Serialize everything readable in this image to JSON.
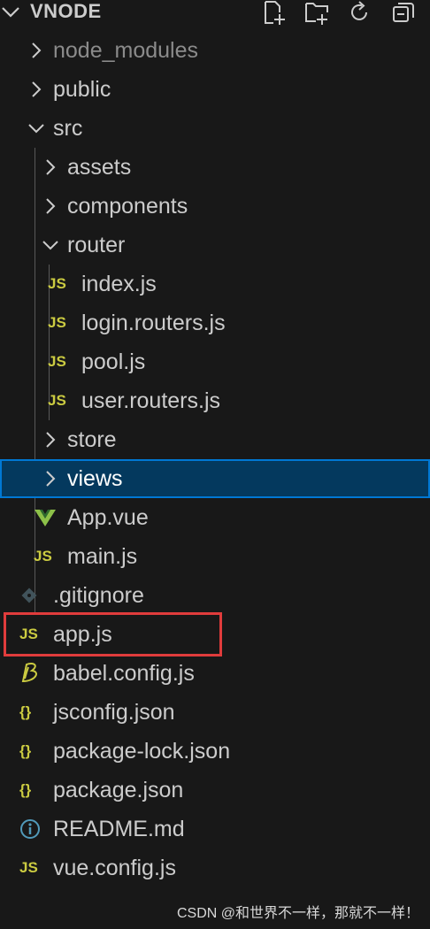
{
  "header": {
    "title": "VNODE",
    "actions": [
      {
        "name": "new-file-icon"
      },
      {
        "name": "new-folder-icon"
      },
      {
        "name": "refresh-icon"
      },
      {
        "name": "collapse-all-icon"
      }
    ]
  },
  "tree": [
    {
      "label": "node_modules",
      "type": "folder",
      "expanded": false,
      "depth": 0,
      "muted": true
    },
    {
      "label": "public",
      "type": "folder",
      "expanded": false,
      "depth": 0
    },
    {
      "label": "src",
      "type": "folder",
      "expanded": true,
      "depth": 0
    },
    {
      "label": "assets",
      "type": "folder",
      "expanded": false,
      "depth": 1
    },
    {
      "label": "components",
      "type": "folder",
      "expanded": false,
      "depth": 1
    },
    {
      "label": "router",
      "type": "folder",
      "expanded": true,
      "depth": 1
    },
    {
      "label": "index.js",
      "type": "js",
      "icon": "JS",
      "depth": 2
    },
    {
      "label": "login.routers.js",
      "type": "js",
      "icon": "JS",
      "depth": 2
    },
    {
      "label": "pool.js",
      "type": "js",
      "icon": "JS",
      "depth": 2
    },
    {
      "label": "user.routers.js",
      "type": "js",
      "icon": "JS",
      "depth": 2
    },
    {
      "label": "store",
      "type": "folder",
      "expanded": false,
      "depth": 1
    },
    {
      "label": "views",
      "type": "folder",
      "expanded": false,
      "depth": 1,
      "selected": true
    },
    {
      "label": "App.vue",
      "type": "vue",
      "depth": 1
    },
    {
      "label": "main.js",
      "type": "js",
      "icon": "JS",
      "depth": 1
    },
    {
      "label": ".gitignore",
      "type": "git",
      "depth": 0
    },
    {
      "label": "app.js",
      "type": "js",
      "icon": "JS",
      "depth": 0,
      "highlighted": true
    },
    {
      "label": "babel.config.js",
      "type": "babel",
      "depth": 0
    },
    {
      "label": "jsconfig.json",
      "type": "json",
      "icon": "{}",
      "depth": 0
    },
    {
      "label": "package-lock.json",
      "type": "json",
      "icon": "{}",
      "depth": 0
    },
    {
      "label": "package.json",
      "type": "json",
      "icon": "{}",
      "depth": 0
    },
    {
      "label": "README.md",
      "type": "info",
      "depth": 0
    },
    {
      "label": "vue.config.js",
      "type": "js",
      "icon": "JS",
      "depth": 0
    }
  ],
  "colors": {
    "background": "#181818",
    "text": "#cccccc",
    "js_icon": "#cbcb41",
    "vue_icon": "#8dc149",
    "info_icon": "#519aba",
    "selected_bg": "#04395e",
    "selected_border": "#0078d4",
    "highlight_box": "#e03c3c"
  },
  "watermark": "CSDN @和世界不一样，那就不一样！"
}
